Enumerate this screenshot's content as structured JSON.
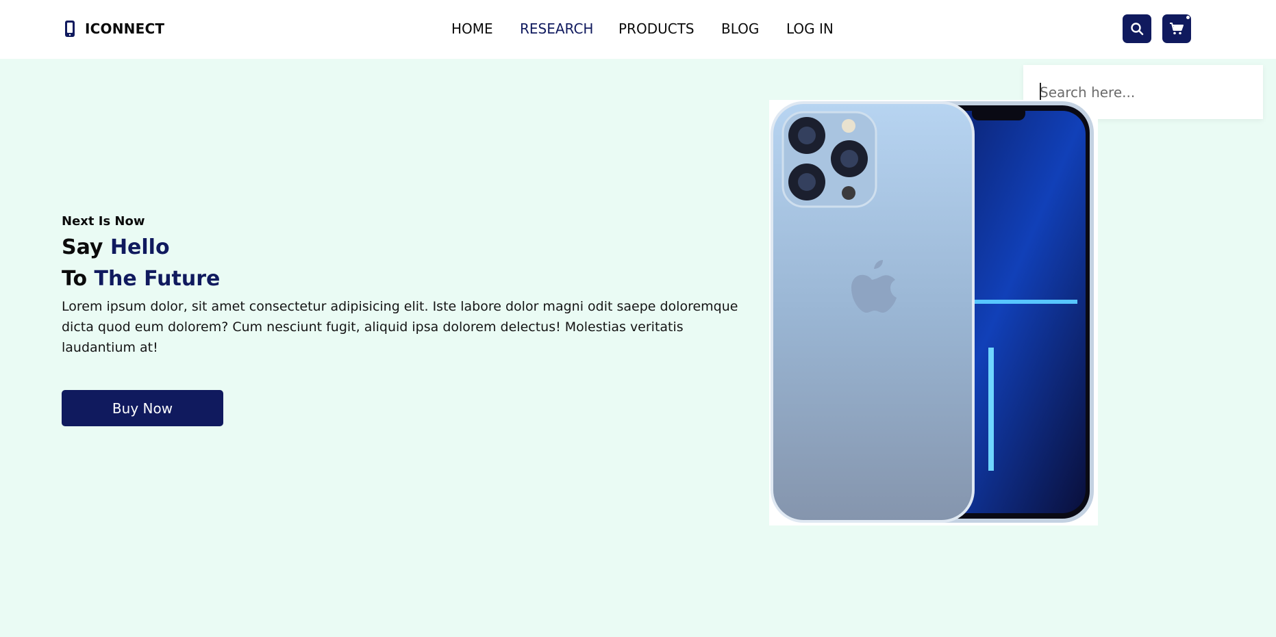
{
  "brand": {
    "name": "ICONNECT",
    "icon": "phone-icon"
  },
  "nav": {
    "items": [
      {
        "label": "HOME",
        "active": false
      },
      {
        "label": "RESEARCH",
        "active": true
      },
      {
        "label": "PRODUCTS",
        "active": false
      },
      {
        "label": "BLOG",
        "active": false
      },
      {
        "label": "LOG IN",
        "active": false
      }
    ]
  },
  "actions": {
    "search_icon": "search-icon",
    "cart_icon": "cart-icon"
  },
  "search": {
    "placeholder": "Search here...",
    "value": ""
  },
  "hero": {
    "tagline": "Next Is Now",
    "line1_prefix": "Say",
    "line1_accent": "Hello",
    "line2_prefix": "To",
    "line2_accent": "The Future",
    "description": "Lorem ipsum dolor, sit amet consectetur adipisicing elit. Iste labore dolor magni odit saepe doloremque dicta quod eum dolorem? Cum nesciunt fugit, aliquid ipsa dolorem delectus! Molestias veritatis laudantium at!",
    "cta_label": "Buy Now"
  },
  "colors": {
    "accent": "#101a5e",
    "background": "#eafbf4",
    "nav_bg": "#ffffff",
    "text": "#0b0b0b"
  }
}
